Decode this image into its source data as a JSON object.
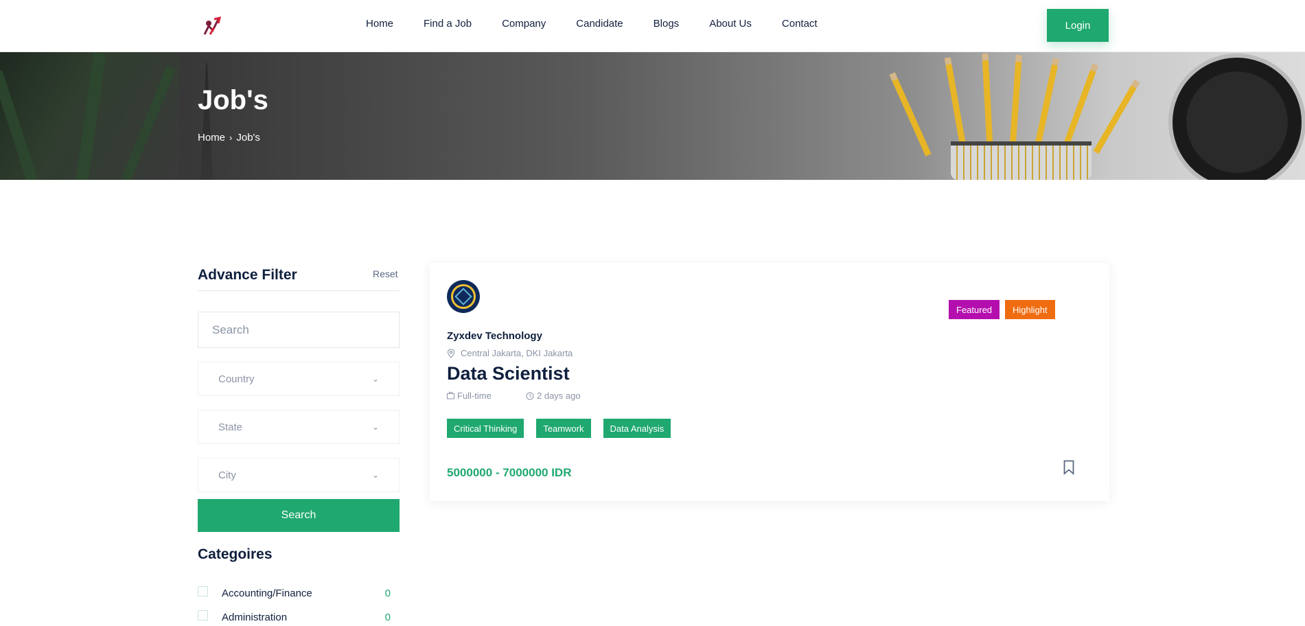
{
  "header": {
    "logo": "brand-logo",
    "nav": [
      "Home",
      "Find a Job",
      "Company",
      "Candidate",
      "Blogs",
      "About Us",
      "Contact"
    ],
    "login_label": "Login"
  },
  "banner": {
    "title": "Job's",
    "breadcrumb": {
      "home": "Home",
      "current": "Job's"
    }
  },
  "filter": {
    "title": "Advance Filter",
    "reset_label": "Reset",
    "search_placeholder": "Search",
    "country_placeholder": "Country",
    "state_placeholder": "State",
    "city_placeholder": "City",
    "search_button": "Search",
    "categories_title": "Categoires",
    "categories": [
      {
        "name": "Accounting/Finance",
        "count": "0"
      },
      {
        "name": "Administration",
        "count": "0"
      }
    ]
  },
  "job": {
    "company": "Zyxdev Technology",
    "location": "Central Jakarta, DKI Jakarta",
    "title": "Data Scientist",
    "type": "Full-time",
    "posted": "2 days ago",
    "badges": [
      "Featured",
      "Highlight"
    ],
    "tags": [
      "Critical Thinking",
      "Teamwork",
      "Data Analysis"
    ],
    "salary": "5000000 - 7000000 IDR"
  },
  "colors": {
    "accent": "#1fa86f",
    "featured": "#b40fae",
    "highlight": "#f06c11",
    "text": "#0f1f3d"
  }
}
